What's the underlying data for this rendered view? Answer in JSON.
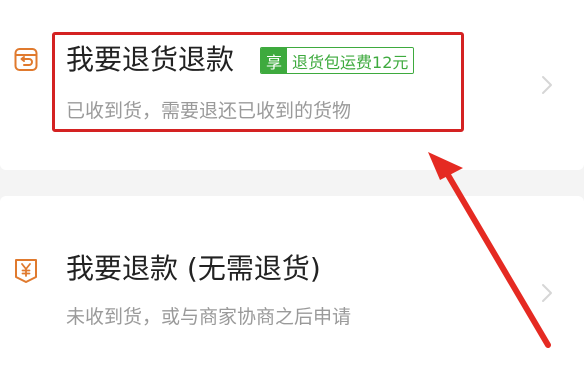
{
  "options": [
    {
      "title": "我要退货退款",
      "subtitle": "已收到货，需要退还已收到的货物",
      "icon": "return-box-icon",
      "badge": {
        "tag": "享",
        "text": "退货包运费12元"
      }
    },
    {
      "title": "我要退款 (无需退货)",
      "subtitle": "未收到货，或与商家协商之后申请",
      "icon": "refund-yuan-icon"
    }
  ],
  "colors": {
    "accent_orange": "#e07a2e",
    "badge_green": "#3eaa3e",
    "highlight_red": "#d42222"
  }
}
